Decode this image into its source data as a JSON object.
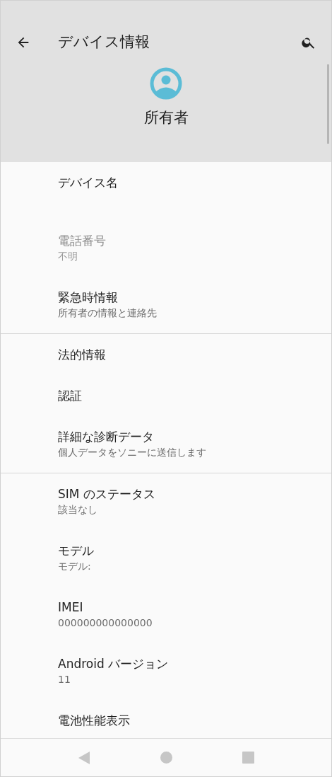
{
  "toolbar": {
    "title": "デバイス情報"
  },
  "owner": {
    "name": "所有者"
  },
  "groups": [
    {
      "items": [
        {
          "title": "デバイス名",
          "disabled": false
        },
        {
          "title": "電話番号",
          "summary": "不明",
          "disabled": true
        },
        {
          "title": "緊急時情報",
          "summary": "所有者の情報と連絡先",
          "disabled": false
        }
      ]
    },
    {
      "items": [
        {
          "title": "法的情報",
          "disabled": false
        },
        {
          "title": "認証",
          "disabled": false
        },
        {
          "title": "詳細な診断データ",
          "summary": "個人データをソニーに送信します",
          "disabled": false
        }
      ]
    },
    {
      "items": [
        {
          "title": "SIM のステータス",
          "summary": "該当なし",
          "disabled": false
        },
        {
          "title": "モデル",
          "summary": "モデル:",
          "disabled": false
        },
        {
          "title": "IMEI",
          "summary": "000000000000000",
          "disabled": false
        },
        {
          "title": "Android バージョン",
          "summary": "11",
          "disabled": false
        },
        {
          "title": "電池性能表示",
          "disabled": false
        }
      ]
    }
  ]
}
